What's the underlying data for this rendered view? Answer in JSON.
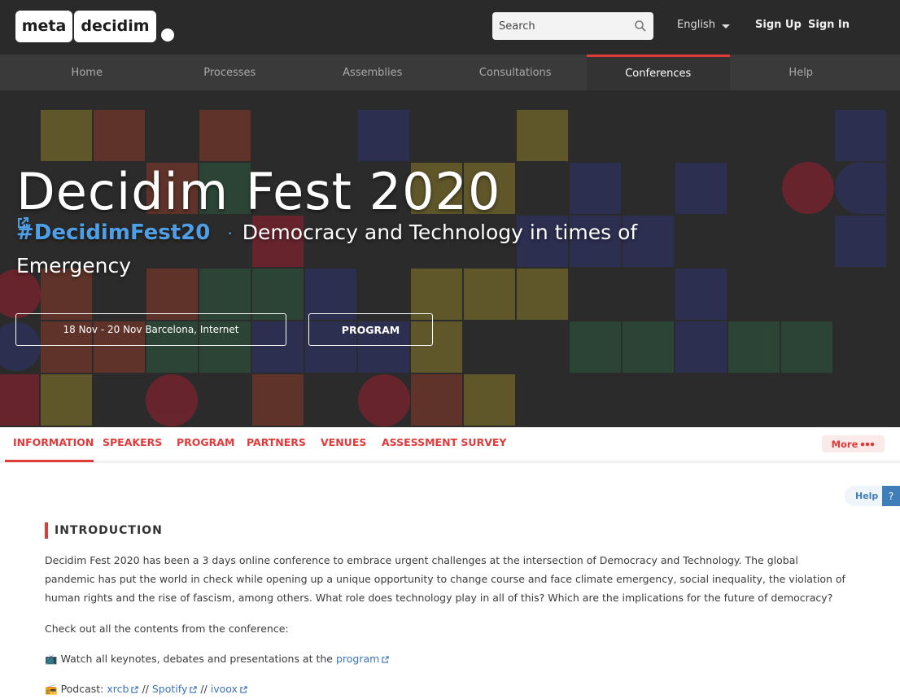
{
  "header": {
    "logo_meta": "meta",
    "logo_decidim": "decidim",
    "search_placeholder": "Search",
    "language": "English",
    "sign_up": "Sign Up",
    "sign_in": "Sign In"
  },
  "nav": {
    "items": [
      {
        "label": "Home"
      },
      {
        "label": "Processes"
      },
      {
        "label": "Assemblies"
      },
      {
        "label": "Consultations"
      },
      {
        "label": "Conferences"
      },
      {
        "label": "Help"
      }
    ],
    "active": "Conferences"
  },
  "hero": {
    "title": "Decidim Fest 2020",
    "hashtag": "#DecidimFest20",
    "separator": "·",
    "slogan": "Democracy and Technology in times of Emergency",
    "dates": "18 Nov - 20 Nov Barcelona, Internet",
    "program_button": "PROGRAM"
  },
  "tabs": {
    "items": [
      {
        "label": "INFORMATION"
      },
      {
        "label": "SPEAKERS"
      },
      {
        "label": "PROGRAM"
      },
      {
        "label": "PARTNERS"
      },
      {
        "label": "VENUES"
      },
      {
        "label": "ASSESSMENT SURVEY"
      }
    ],
    "more": "More"
  },
  "help": {
    "label": "Help",
    "icon_label": "?"
  },
  "content": {
    "section_title": "INTRODUCTION",
    "intro": "Decidim Fest 2020 has been a 3 days online conference to embrace urgent challenges at the intersection of Democracy and Technology. The global pandemic has put the world in check while opening up a unique opportunity to change course and face climate emergency, social inequality, the violation of human rights and the rise of fascism, among others. What role does technology play in all of this? Which are the implications for the future of democracy?",
    "check_out": "Check out all the contents from the conference:",
    "watch_emoji": "📺",
    "watch_text": "Watch all keynotes, debates and presentations at the",
    "watch_link": "program",
    "podcast_emoji": "📻",
    "podcast_text": "Podcast:",
    "podcast_links": [
      "xrcb",
      "Spotify",
      "ivoox"
    ],
    "podcast_sep": "//"
  },
  "colors": {
    "accent": "#e03b3b",
    "link": "#3a73b8",
    "topbar": "#2a2a2a",
    "nav": "#3a3a3a"
  }
}
